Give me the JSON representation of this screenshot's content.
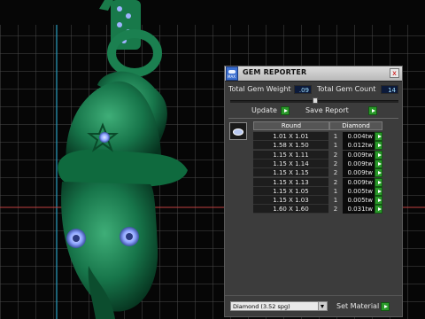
{
  "panel": {
    "title": "GEM REPORTER",
    "app_icon_label": "MAX",
    "close_glyph": "x",
    "total_weight_label": "Total Gem Weight",
    "total_weight_value": ".09",
    "total_count_label": "Total Gem Count",
    "total_count_value": "14",
    "update_label": "Update",
    "save_report_label": "Save Report",
    "table": {
      "headers": [
        "Round",
        "Diamond"
      ],
      "rows": [
        {
          "size": "1.01 X 1.01",
          "count": "1",
          "weight": "0.004tw"
        },
        {
          "size": "1.58 X 1.50",
          "count": "1",
          "weight": "0.012tw"
        },
        {
          "size": "1.15 X 1.11",
          "count": "2",
          "weight": "0.009tw"
        },
        {
          "size": "1.15 X 1.14",
          "count": "2",
          "weight": "0.009tw"
        },
        {
          "size": "1.15 X 1.15",
          "count": "2",
          "weight": "0.009tw"
        },
        {
          "size": "1.15 X 1.13",
          "count": "2",
          "weight": "0.009tw"
        },
        {
          "size": "1.15 X 1.05",
          "count": "1",
          "weight": "0.005tw"
        },
        {
          "size": "1.15 X 1.03",
          "count": "1",
          "weight": "0.005tw"
        },
        {
          "size": "1.60 X 1.60",
          "count": "2",
          "weight": "0.031tw"
        }
      ]
    },
    "material_select": "Diamond     (3.52 spg)",
    "set_material_label": "Set Material"
  },
  "colors": {
    "model": "#1d7a4a",
    "grid": "#4a4a4a",
    "accent_green": "#2a9a2a",
    "gem_blue": "#9fb3ff"
  }
}
